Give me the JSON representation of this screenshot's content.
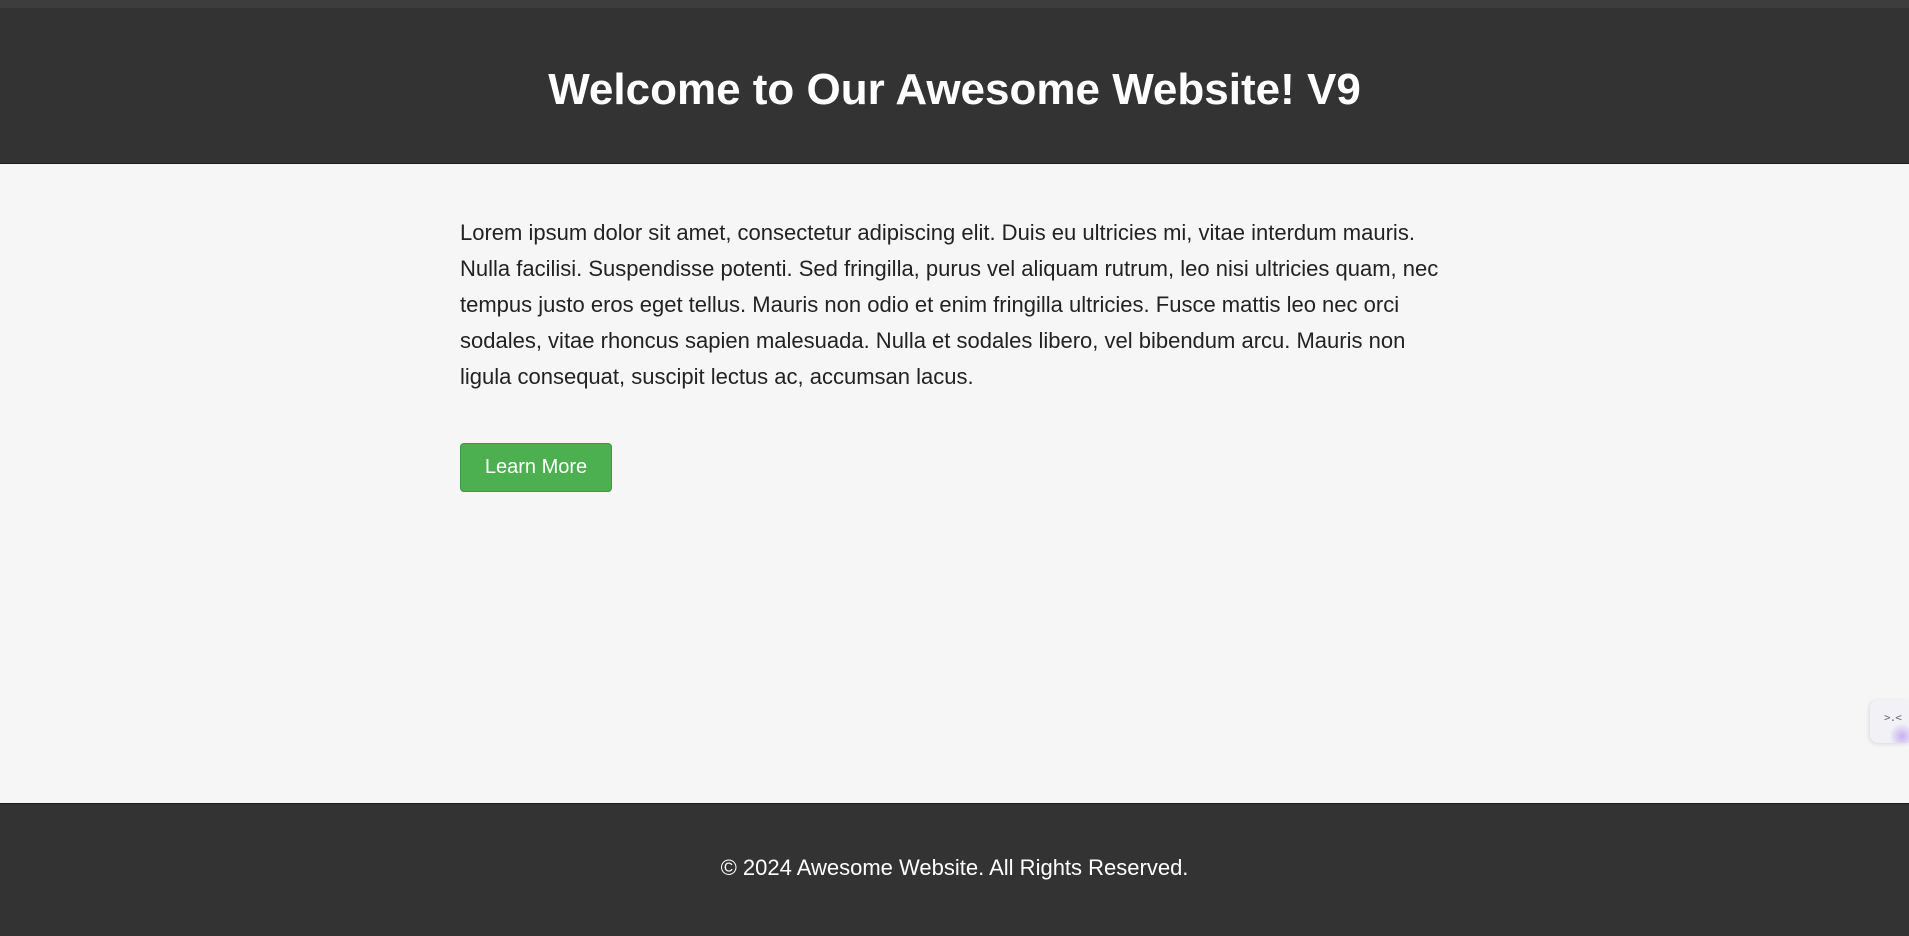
{
  "header": {
    "title": "Welcome to Our Awesome Website! V9"
  },
  "main": {
    "paragraph": "Lorem ipsum dolor sit amet, consectetur adipiscing elit. Duis eu ultricies mi, vitae interdum mauris. Nulla facilisi. Suspendisse potenti. Sed fringilla, purus vel aliquam rutrum, leo nisi ultricies quam, nec tempus justo eros eget tellus. Mauris non odio et enim fringilla ultricies. Fusce mattis leo nec orci sodales, vitae rhoncus sapien malesuada. Nulla et sodales libero, vel bibendum arcu. Mauris non ligula consequat, suscipit lectus ac, accumsan lacus.",
    "button_label": "Learn More"
  },
  "footer": {
    "copyright": "© 2024 Awesome Website. All Rights Reserved."
  },
  "widget": {
    "icon": "assistant-face-icon",
    "glyph": ">.<"
  },
  "colors": {
    "header_bg": "#333333",
    "body_bg": "#f6f6f6",
    "button_bg": "#4caf50",
    "text_light": "#ffffff"
  }
}
